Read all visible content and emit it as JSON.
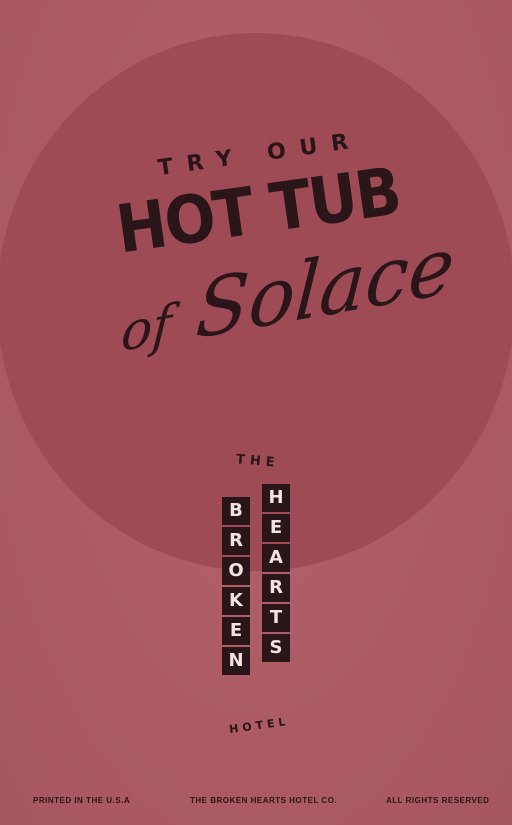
{
  "poster": {
    "background_color": "#b15c66",
    "circle_color": "#9f4b56",
    "ink_color": "#2a1518"
  },
  "headline": {
    "try_our": "TRY OUR",
    "hot_tub": "HOT TUB",
    "of": "of",
    "solace": "Solace"
  },
  "logo": {
    "the": "THE",
    "broken": [
      "B",
      "R",
      "O",
      "K",
      "E",
      "N"
    ],
    "hearts": [
      "H",
      "E",
      "A",
      "R",
      "T",
      "S"
    ],
    "hotel": "HOTEL"
  },
  "footer": {
    "left": "PRINTED IN THE U.S.A",
    "center": "THE BROKEN HEARTS HOTEL CO.",
    "right": "ALL RIGHTS RESERVED"
  }
}
